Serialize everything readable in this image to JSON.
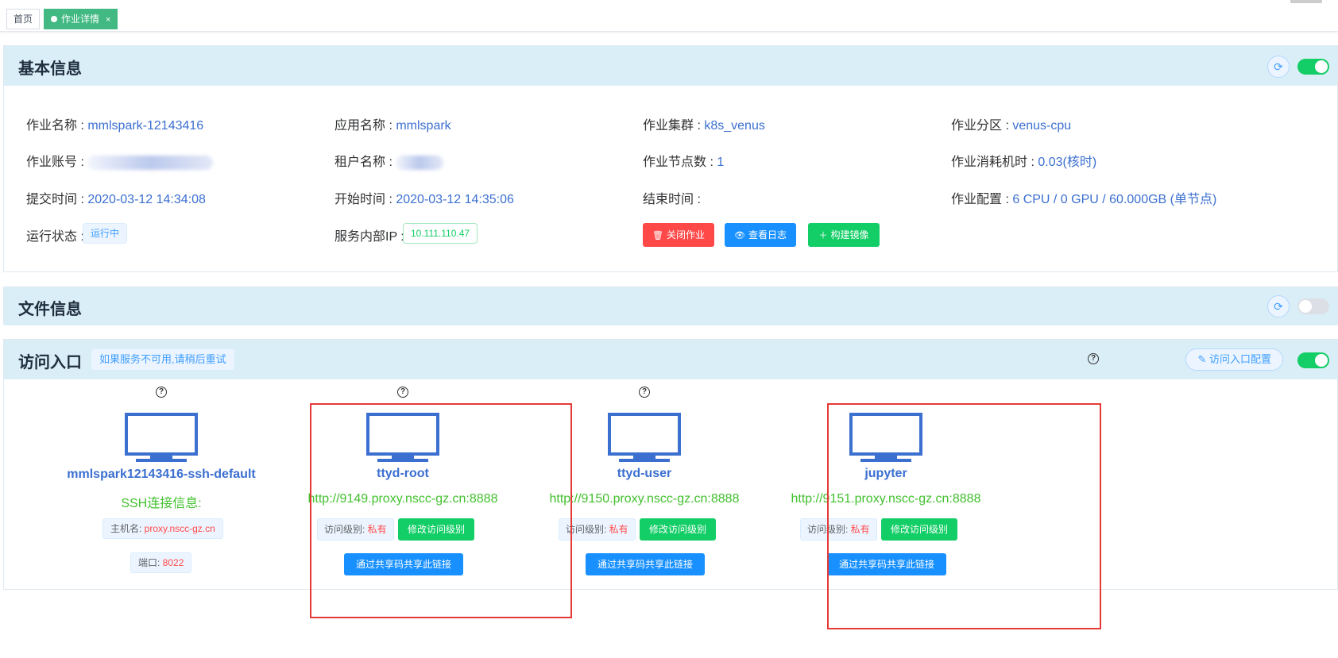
{
  "tabs": {
    "home": "首页",
    "active": "作业详情",
    "close": "×"
  },
  "basic": {
    "title": "基本信息",
    "refresh_icon": "refresh-icon",
    "switch_on": true,
    "fields": {
      "job_name_label": "作业名称 : ",
      "job_name": "mmlspark-12143416",
      "app_name_label": "应用名称 : ",
      "app_name": "mmlspark",
      "cluster_label": "作业集群 : ",
      "cluster": "k8s_venus",
      "partition_label": "作业分区 : ",
      "partition": "venus-cpu",
      "account_label": "作业账号 : ",
      "tenant_label": "租户名称 : ",
      "nodes_label": "作业节点数 : ",
      "nodes": "1",
      "cost_label": "作业消耗机时 : ",
      "cost": "0.03(核时)",
      "submit_label": "提交时间 : ",
      "submit": "2020-03-12 14:34:08",
      "start_label": "开始时间 : ",
      "start": "2020-03-12 14:35:06",
      "end_label": "结束时间 : ",
      "config_label": "作业配置 : ",
      "config": "6 CPU / 0 GPU / 60.000GB (单节点)",
      "status_label": "运行状态 : ",
      "status": "运行中",
      "ip_label": "服务内部IP : ",
      "ip": "10.111.110.47"
    },
    "buttons": {
      "close_job": "关闭作业",
      "view_log": "查看日志",
      "build_image": "构建镜像"
    }
  },
  "files": {
    "title": "文件信息",
    "switch_on": false
  },
  "access": {
    "title": "访问入口",
    "hint": "如果服务不可用,请稍后重试",
    "config_button": "访问入口配置",
    "switch_on": true,
    "ssh": {
      "name": "mmlspark12143416-ssh-default",
      "info": "SSH连接信息:",
      "host_label": "主机名: ",
      "host": "proxy.nscc-gz.cn",
      "port_label": "端口: ",
      "port": "8022"
    },
    "entries": [
      {
        "name": "ttyd-root",
        "url": "http://9149.proxy.nscc-gz.cn:8888",
        "level_label": "访问级别: ",
        "level": "私有",
        "modify": "修改访问级别",
        "share": "通过共享码共享此链接"
      },
      {
        "name": "ttyd-user",
        "url": "http://9150.proxy.nscc-gz.cn:8888",
        "level_label": "访问级别: ",
        "level": "私有",
        "modify": "修改访问级别",
        "share": "通过共享码共享此链接"
      },
      {
        "name": "jupyter",
        "url": "http://9151.proxy.nscc-gz.cn:8888",
        "level_label": "访问级别: ",
        "level": "私有",
        "modify": "修改访问级别",
        "share": "通过共享码共享此链接"
      }
    ],
    "help_mark": "?"
  },
  "colors": {
    "accent": "#3b6fd0",
    "success": "#13ce66",
    "danger": "#ff4949",
    "primary": "#1890ff",
    "header_bg": "#daeef7",
    "highlight_box": "#e53935"
  }
}
